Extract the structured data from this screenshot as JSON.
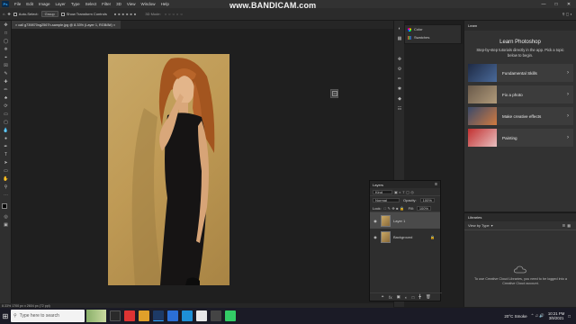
{
  "menu": {
    "logo": "Ps",
    "items": [
      "File",
      "Edit",
      "Image",
      "Layer",
      "Type",
      "Select",
      "Filter",
      "3D",
      "View",
      "Window",
      "Help"
    ]
  },
  "watermark": "www.BANDICAM.com",
  "options": {
    "auto_select_label": "Auto-Select:",
    "auto_select_value": "Group",
    "show_transform_label": "Show Transform Controls",
    "mode_label": "3D Mode:"
  },
  "tab": {
    "title": "× call g739870ng2567h-sample.jpg @ 8.33% (Layer 1, RGB/8#) ×"
  },
  "status": {
    "text": "8.33%     1700 px x 2604 px (72 ppi)"
  },
  "color_panel": {
    "color_label": "Color",
    "swatches_label": "Swatches"
  },
  "layers": {
    "panel_title": "Layers",
    "kind_label": "Kind",
    "blend_mode": "Normal",
    "opacity_label": "Opacity:",
    "opacity_value": "100%",
    "lock_label": "Lock:",
    "fill_label": "Fill:",
    "fill_value": "100%",
    "rows": [
      {
        "name": "Layer 1",
        "selected": true
      },
      {
        "name": "Background",
        "selected": false
      }
    ]
  },
  "learn": {
    "tab_label": "Learn",
    "title": "Learn Photoshop",
    "desc": "Step-by-step tutorials directly in the app. Pick a topic below to begin.",
    "cards": [
      {
        "label": "Fundamental Skills",
        "thumb_color": "#1e2a44"
      },
      {
        "label": "Fix a photo",
        "thumb_color": "#6a5a4a"
      },
      {
        "label": "Make creative effects",
        "thumb_color": "#3a4a6a"
      },
      {
        "label": "Painting",
        "thumb_color": "#c23030"
      }
    ]
  },
  "libraries": {
    "tab_label": "Libraries",
    "view_label": "View by Type",
    "message": "To use Creative Cloud Libraries, you need to be logged into a Creative Cloud account."
  },
  "taskbar": {
    "search_placeholder": "Type here to search",
    "weather": "20°C  Smoke",
    "time": "10:21 PM",
    "date": "3/9/2021"
  },
  "colors": {
    "accent": "#31a8ff",
    "panel_bg": "#323232",
    "canvas_bg": "#1f1f1f"
  }
}
